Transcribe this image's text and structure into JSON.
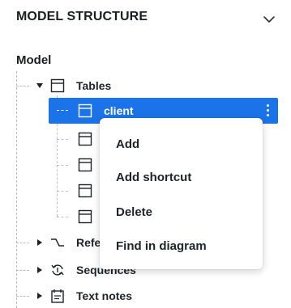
{
  "panel": {
    "title": "MODEL STRUCTURE",
    "root_label": "Model"
  },
  "tree": {
    "tables_label": "Tables",
    "selected_label": "client",
    "refs_label": "Refe",
    "sequences_label": "Sequences",
    "text_notes_label": "Text notes"
  },
  "context_menu": {
    "items": [
      {
        "label": "Add"
      },
      {
        "label": "Add shortcut"
      },
      {
        "label": "Delete"
      },
      {
        "label": "Find in diagram"
      }
    ]
  },
  "icons": {
    "collapse": "chevron-down-icon",
    "table": "table-icon",
    "reference": "reference-icon",
    "sequence": "sequence-icon",
    "note": "note-icon",
    "more": "more-vertical-icon"
  },
  "colors": {
    "selection": "#1a73e8",
    "text": "#1f2328"
  }
}
